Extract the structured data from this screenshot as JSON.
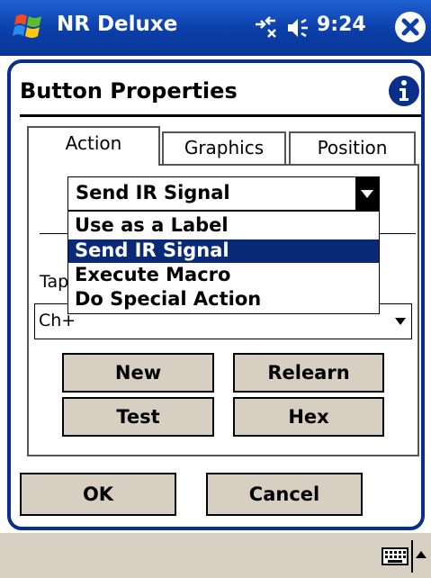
{
  "titlebar": {
    "app_title": "NR Deluxe",
    "time": "9:24",
    "icons": [
      "windows-start-icon",
      "connectivity-icon",
      "volume-icon",
      "close-icon"
    ]
  },
  "dialog": {
    "title": "Button Properties",
    "info_icon": "info-icon"
  },
  "tabs": [
    {
      "label": "Action",
      "active": true
    },
    {
      "label": "Graphics",
      "active": false
    },
    {
      "label": "Position",
      "active": false
    }
  ],
  "action_combo": {
    "value": "Send IR Signal",
    "options": [
      {
        "label": "Use as a Label",
        "selected": false
      },
      {
        "label": "Send IR Signal",
        "selected": true
      },
      {
        "label": "Execute Macro",
        "selected": false
      },
      {
        "label": "Do Special Action",
        "selected": false
      }
    ]
  },
  "tap_label": "Tap",
  "signal_select": {
    "value": "Ch+"
  },
  "buttons": {
    "new": "New",
    "relearn": "Relearn",
    "test": "Test",
    "hex": "Hex",
    "ok": "OK",
    "cancel": "Cancel"
  },
  "colors": {
    "titlebar": "#0b3ea8",
    "frame": "#0a2f8a",
    "selection": "#0a2a78",
    "button_face": "#d8cfc3",
    "bottom_bar": "#d9d0c4"
  }
}
